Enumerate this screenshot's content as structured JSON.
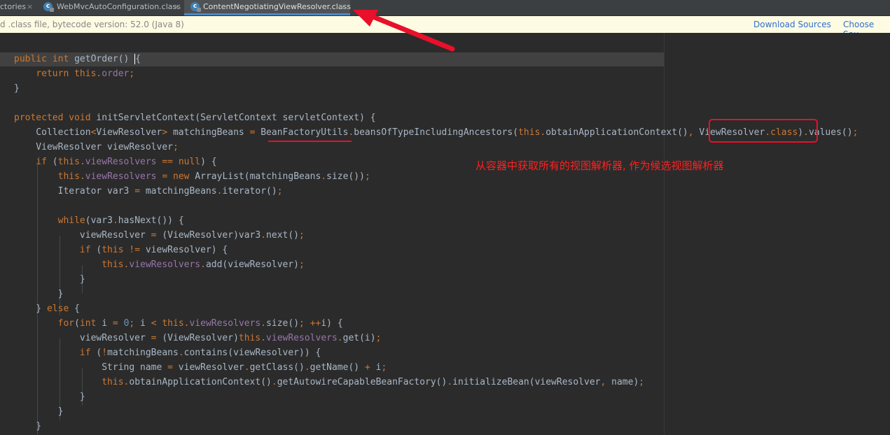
{
  "tabs": [
    {
      "label": "ctories",
      "active": false
    },
    {
      "label": "WebMvcAutoConfiguration.class",
      "active": false
    },
    {
      "label": "ContentNegotiatingViewResolver.class",
      "active": true
    }
  ],
  "tab_close_glyph": "×",
  "class_icon_letter": "c",
  "banner": {
    "text": "d .class file, bytecode version: 52.0 (Java 8)",
    "download_sources": "Download Sources",
    "choose_sources": "Choose Sou"
  },
  "annotation": "从容器中获取所有的视图解析器, 作为候选视图解析器",
  "colors": {
    "keyword": "#cc7832",
    "field": "#9876aa",
    "number": "#6897bb",
    "text": "#a9b7c6",
    "annotation_red": "#e8102a",
    "link": "#2f6fcf"
  },
  "code_lines": [
    [
      [
        "k",
        "public"
      ],
      [
        "",
        " "
      ],
      [
        "k",
        "int"
      ],
      [
        "",
        " getOrder() "
      ],
      [
        "cur",
        "{"
      ]
    ],
    [
      [
        "",
        "    "
      ],
      [
        "k",
        "return"
      ],
      [
        "",
        " "
      ],
      [
        "k",
        "this"
      ],
      [
        "p",
        "."
      ],
      [
        "f",
        "order"
      ],
      [
        "p",
        ";"
      ]
    ],
    [
      [
        "",
        "}"
      ]
    ],
    [],
    [
      [
        "k",
        "protected"
      ],
      [
        "",
        " "
      ],
      [
        "k",
        "void"
      ],
      [
        "",
        " initServletContext(ServletContext servletContext) {"
      ]
    ],
    [
      [
        "",
        "    Collection"
      ],
      [
        "p",
        "<"
      ],
      [
        "",
        "ViewResolver"
      ],
      [
        "p",
        ">"
      ],
      [
        "",
        " matchingBeans "
      ],
      [
        "p",
        "="
      ],
      [
        "",
        " BeanFactoryUtils"
      ],
      [
        "p",
        "."
      ],
      [
        "",
        "beansOfTypeIncludingAncestors("
      ],
      [
        "k",
        "this"
      ],
      [
        "p",
        "."
      ],
      [
        "",
        "obtainApplicationContext()"
      ],
      [
        "p",
        ","
      ],
      [
        "",
        " ViewResolver"
      ],
      [
        "p",
        "."
      ],
      [
        "k",
        "class"
      ],
      [
        "",
        ")"
      ],
      [
        "p",
        "."
      ],
      [
        "",
        "values()"
      ],
      [
        "p",
        ";"
      ]
    ],
    [
      [
        "",
        "    ViewResolver viewResolver"
      ],
      [
        "p",
        ";"
      ]
    ],
    [
      [
        "",
        "    "
      ],
      [
        "k",
        "if"
      ],
      [
        "",
        " ("
      ],
      [
        "k",
        "this"
      ],
      [
        "p",
        "."
      ],
      [
        "f",
        "viewResolvers"
      ],
      [
        "",
        " "
      ],
      [
        "p",
        "=="
      ],
      [
        "",
        " "
      ],
      [
        "k",
        "null"
      ],
      [
        "",
        ") {"
      ]
    ],
    [
      [
        "",
        "        "
      ],
      [
        "k",
        "this"
      ],
      [
        "p",
        "."
      ],
      [
        "f",
        "viewResolvers"
      ],
      [
        "",
        " "
      ],
      [
        "p",
        "="
      ],
      [
        "",
        " "
      ],
      [
        "k",
        "new"
      ],
      [
        "",
        " ArrayList(matchingBeans"
      ],
      [
        "p",
        "."
      ],
      [
        "",
        "size())"
      ],
      [
        "p",
        ";"
      ]
    ],
    [
      [
        "",
        "        Iterator var3 "
      ],
      [
        "p",
        "="
      ],
      [
        "",
        " matchingBeans"
      ],
      [
        "p",
        "."
      ],
      [
        "",
        "iterator()"
      ],
      [
        "p",
        ";"
      ]
    ],
    [],
    [
      [
        "",
        "        "
      ],
      [
        "k",
        "while"
      ],
      [
        "",
        "(var3"
      ],
      [
        "p",
        "."
      ],
      [
        "",
        "hasNext()) {"
      ]
    ],
    [
      [
        "",
        "            viewResolver "
      ],
      [
        "p",
        "="
      ],
      [
        "",
        " (ViewResolver)var3"
      ],
      [
        "p",
        "."
      ],
      [
        "",
        "next()"
      ],
      [
        "p",
        ";"
      ]
    ],
    [
      [
        "",
        "            "
      ],
      [
        "k",
        "if"
      ],
      [
        "",
        " ("
      ],
      [
        "k",
        "this"
      ],
      [
        "",
        " "
      ],
      [
        "p",
        "!="
      ],
      [
        "",
        " viewResolver) {"
      ]
    ],
    [
      [
        "",
        "                "
      ],
      [
        "k",
        "this"
      ],
      [
        "p",
        "."
      ],
      [
        "f",
        "viewResolvers"
      ],
      [
        "p",
        "."
      ],
      [
        "",
        "add(viewResolver)"
      ],
      [
        "p",
        ";"
      ]
    ],
    [
      [
        "",
        "            }"
      ]
    ],
    [
      [
        "",
        "        }"
      ]
    ],
    [
      [
        "",
        "    } "
      ],
      [
        "k",
        "else"
      ],
      [
        "",
        " {"
      ]
    ],
    [
      [
        "",
        "        "
      ],
      [
        "k",
        "for"
      ],
      [
        "",
        "("
      ],
      [
        "k",
        "int"
      ],
      [
        "",
        " i "
      ],
      [
        "p",
        "="
      ],
      [
        "",
        " "
      ],
      [
        "n",
        "0"
      ],
      [
        "p",
        ";"
      ],
      [
        "",
        " i "
      ],
      [
        "p",
        "<"
      ],
      [
        "",
        " "
      ],
      [
        "k",
        "this"
      ],
      [
        "p",
        "."
      ],
      [
        "f",
        "viewResolvers"
      ],
      [
        "p",
        "."
      ],
      [
        "",
        "size()"
      ],
      [
        "p",
        ";"
      ],
      [
        "",
        " "
      ],
      [
        "p",
        "++"
      ],
      [
        "",
        "i) {"
      ]
    ],
    [
      [
        "",
        "            viewResolver "
      ],
      [
        "p",
        "="
      ],
      [
        "",
        " (ViewResolver)"
      ],
      [
        "k",
        "this"
      ],
      [
        "p",
        "."
      ],
      [
        "f",
        "viewResolvers"
      ],
      [
        "p",
        "."
      ],
      [
        "",
        "get(i)"
      ],
      [
        "p",
        ";"
      ]
    ],
    [
      [
        "",
        "            "
      ],
      [
        "k",
        "if"
      ],
      [
        "",
        " ("
      ],
      [
        "p",
        "!"
      ],
      [
        "",
        "matchingBeans"
      ],
      [
        "p",
        "."
      ],
      [
        "",
        "contains(viewResolver)) {"
      ]
    ],
    [
      [
        "",
        "                String name "
      ],
      [
        "p",
        "="
      ],
      [
        "",
        " viewResolver"
      ],
      [
        "p",
        "."
      ],
      [
        "",
        "getClass()"
      ],
      [
        "p",
        "."
      ],
      [
        "",
        "getName() "
      ],
      [
        "p",
        "+"
      ],
      [
        "",
        " i"
      ],
      [
        "p",
        ";"
      ]
    ],
    [
      [
        "",
        "                "
      ],
      [
        "k",
        "this"
      ],
      [
        "p",
        "."
      ],
      [
        "",
        "obtainApplicationContext()"
      ],
      [
        "p",
        "."
      ],
      [
        "",
        "getAutowireCapableBeanFactory()"
      ],
      [
        "p",
        "."
      ],
      [
        "",
        "initializeBean(viewResolver"
      ],
      [
        "p",
        ","
      ],
      [
        "",
        " name)"
      ],
      [
        "p",
        ";"
      ]
    ],
    [
      [
        "",
        "            }"
      ]
    ],
    [
      [
        "",
        "        }"
      ]
    ],
    [
      [
        "",
        "    }"
      ]
    ],
    [
      [
        "",
        "    "
      ]
    ]
  ]
}
